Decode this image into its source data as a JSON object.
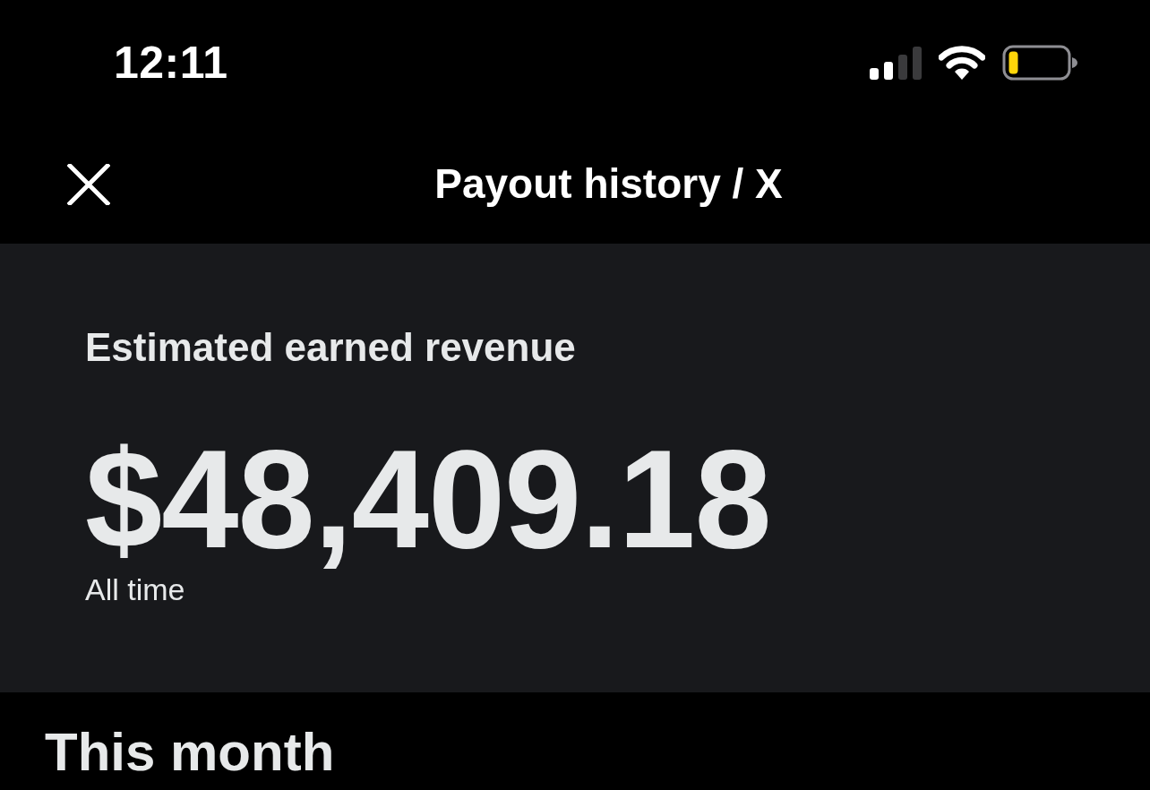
{
  "status_bar": {
    "time": "12:11"
  },
  "header": {
    "title": "Payout history / X"
  },
  "revenue_card": {
    "label": "Estimated earned revenue",
    "amount": "$48,409.18",
    "period": "All time"
  },
  "sections": [
    {
      "heading": "This month"
    }
  ]
}
